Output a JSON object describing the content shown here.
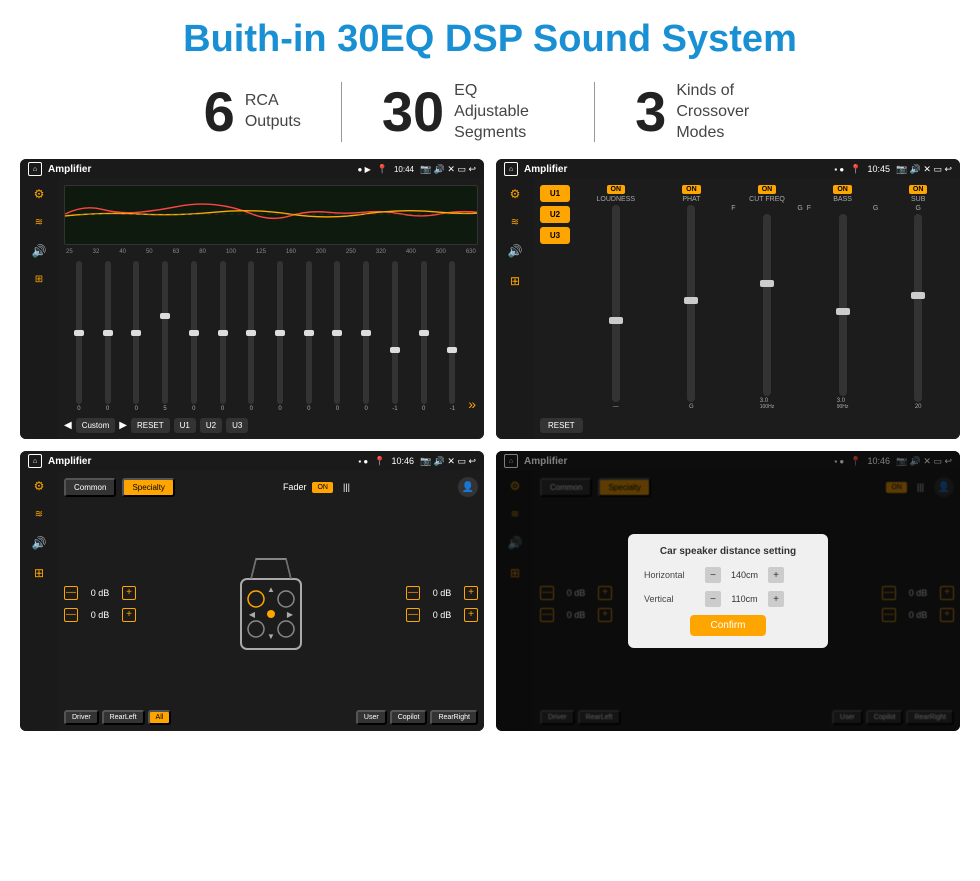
{
  "page": {
    "title": "Buith-in 30EQ DSP Sound System"
  },
  "stats": [
    {
      "number": "6",
      "text": "RCA\nOutputs"
    },
    {
      "number": "30",
      "text": "EQ Adjustable\nSegments"
    },
    {
      "number": "3",
      "text": "Kinds of\nCrossover Modes"
    }
  ],
  "screens": [
    {
      "id": "eq-screen",
      "statusBar": {
        "appTitle": "Amplifier",
        "time": "10:44"
      },
      "freqLabels": [
        "25",
        "32",
        "40",
        "50",
        "63",
        "80",
        "100",
        "125",
        "160",
        "200",
        "250",
        "320",
        "400",
        "500",
        "630"
      ],
      "sliderValues": [
        "0",
        "0",
        "0",
        "5",
        "0",
        "0",
        "0",
        "0",
        "0",
        "0",
        "0",
        "-1",
        "0",
        "-1"
      ],
      "bottomButtons": [
        "Custom",
        "RESET",
        "U1",
        "U2",
        "U3"
      ]
    },
    {
      "id": "crossover-screen",
      "statusBar": {
        "appTitle": "Amplifier",
        "time": "10:45"
      },
      "uButtons": [
        "U1",
        "U2",
        "U3"
      ],
      "columns": [
        {
          "label": "LOUDNESS",
          "on": true
        },
        {
          "label": "PHAT",
          "on": true
        },
        {
          "label": "CUT FREQ",
          "on": true
        },
        {
          "label": "BASS",
          "on": true
        },
        {
          "label": "SUB",
          "on": true
        }
      ],
      "resetLabel": "RESET"
    },
    {
      "id": "fader-screen",
      "statusBar": {
        "appTitle": "Amplifier",
        "time": "10:46"
      },
      "tabs": [
        "Common",
        "Specialty"
      ],
      "faderLabel": "Fader",
      "onToggle": "ON",
      "rows": [
        {
          "value": "0 dB"
        },
        {
          "value": "0 dB"
        },
        {
          "value": "0 dB"
        },
        {
          "value": "0 dB"
        }
      ],
      "bottomButtons": [
        "Driver",
        "RearLeft",
        "All",
        "User",
        "Copilot",
        "RearRight"
      ]
    },
    {
      "id": "distance-screen",
      "statusBar": {
        "appTitle": "Amplifier",
        "time": "10:46"
      },
      "tabs": [
        "Common",
        "Specialty"
      ],
      "dialog": {
        "title": "Car speaker distance setting",
        "fields": [
          {
            "label": "Horizontal",
            "value": "140cm"
          },
          {
            "label": "Vertical",
            "value": "110cm"
          }
        ],
        "confirmLabel": "Confirm"
      },
      "rows": [
        {
          "value": "0 dB"
        },
        {
          "value": "0 dB"
        }
      ],
      "bottomButtons": [
        "Driver",
        "RearLeft",
        "All",
        "User",
        "Copilot",
        "RearRight"
      ]
    }
  ]
}
